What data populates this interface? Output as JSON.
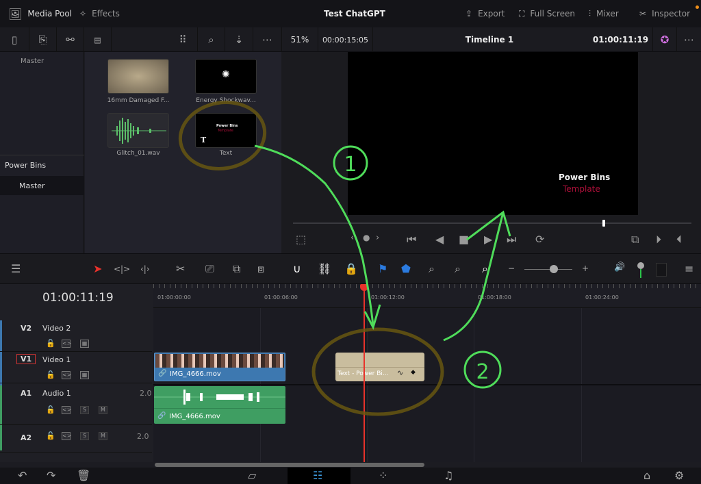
{
  "topbar": {
    "media_pool_label": "Media Pool",
    "effects_label": "Effects",
    "project_title": "Test ChatGPT",
    "export_label": "Export",
    "full_screen_label": "Full Screen",
    "mixer_label": "Mixer",
    "inspector_label": "Inspector"
  },
  "viewer_bar": {
    "zoom": "51%",
    "duration": "00:00:15:05",
    "timeline_name": "Timeline 1",
    "timecode": "01:00:11:19"
  },
  "sidebar": {
    "master_label": "Master",
    "power_bins_label": "Power Bins",
    "power_bins_master": "Master"
  },
  "media_pool": {
    "clips": [
      {
        "name": "16mm Damaged F..."
      },
      {
        "name": "Energy Shockwav..."
      },
      {
        "name": "Glitch_01.wav"
      },
      {
        "name": "Text",
        "thumb_title": "Power Bins",
        "thumb_sub": "Template"
      }
    ]
  },
  "viewer": {
    "title_line1": "Power Bins",
    "title_line2": "Template"
  },
  "playback": {
    "scrub_position": 0.78
  },
  "timeline": {
    "timecode": "01:00:11:19",
    "ruler_ticks": [
      "01:00:00:00",
      "01:00:06:00",
      "01:00:12:00",
      "01:00:18:00",
      "01:00:24:00"
    ],
    "tracks": [
      {
        "id": "V2",
        "name": "Video 2"
      },
      {
        "id": "V1",
        "name": "Video 1"
      },
      {
        "id": "A1",
        "name": "Audio 1",
        "channels": "2.0"
      },
      {
        "id": "A2",
        "name": "",
        "channels": "2.0"
      }
    ],
    "solo_label": "S",
    "mute_label": "M",
    "clips": {
      "video_clip": "IMG_4666.mov",
      "audio_clip": "IMG_4666.mov",
      "text_clip": "Text - Power Bi..."
    }
  },
  "annotations": {
    "step1": "1",
    "step2": "2"
  },
  "colors": {
    "playhead": "#e8322b",
    "video_clip": "#3d78b0",
    "audio_clip": "#3f9e62",
    "text_clip": "#c9bd9e",
    "annotation_green": "#4fdc5a",
    "annotation_circle": "#6b5a10",
    "template_red": "#b0103a"
  }
}
